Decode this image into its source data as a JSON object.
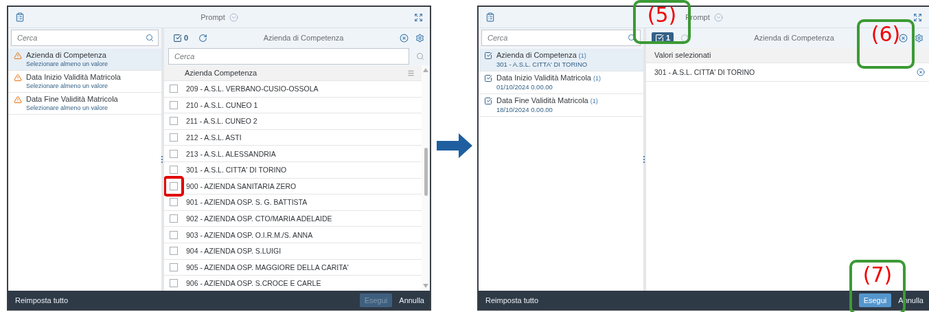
{
  "screens": [
    {
      "title": "Prompt",
      "search": {
        "placeholder": "Cerca"
      },
      "prompts": [
        {
          "label": "Azienda di Competenza",
          "kind": "missing",
          "note": "Selezionare almeno un valore",
          "selected": true
        },
        {
          "label": "Data Inizio Validità Matricola",
          "kind": "missing",
          "note": "Selezionare almeno un valore",
          "selected": false
        },
        {
          "label": "Data Fine Validità Matricola",
          "kind": "missing",
          "note": "Selezionare almeno un valore",
          "selected": false
        }
      ],
      "panel": {
        "kind": "list",
        "selection_count": {
          "label": "0",
          "active": false
        },
        "refresh_disabled": false,
        "title": "Azienda di Competenza",
        "search": {
          "placeholder": "Cerca"
        },
        "column": "Azienda Competenza",
        "rows": [
          {
            "label": "209 - A.S.L. VERBANO-CUSIO-OSSOLA",
            "checked": false,
            "marked": false
          },
          {
            "label": "210 - A.S.L. CUNEO 1",
            "checked": false,
            "marked": false
          },
          {
            "label": "211 - A.S.L. CUNEO 2",
            "checked": false,
            "marked": false
          },
          {
            "label": "212 - A.S.L. ASTI",
            "checked": false,
            "marked": false
          },
          {
            "label": "213 - A.S.L. ALESSANDRIA",
            "checked": false,
            "marked": false
          },
          {
            "label": "301 - A.S.L. CITTA' DI TORINO",
            "checked": false,
            "marked": false
          },
          {
            "label": "900 - AZIENDA SANITARIA ZERO",
            "checked": false,
            "marked": true
          },
          {
            "label": "901 - AZIENDA OSP. S. G. BATTISTA",
            "checked": false,
            "marked": false
          },
          {
            "label": "902 - AZIENDA OSP. CTO/MARIA ADELAIDE",
            "checked": false,
            "marked": false
          },
          {
            "label": "903 - AZIENDA OSP. O.I.R.M./S. ANNA",
            "checked": false,
            "marked": false
          },
          {
            "label": "904 - AZIENDA OSP. S.LUIGI",
            "checked": false,
            "marked": false
          },
          {
            "label": "905 - AZIENDA OSP. MAGGIORE DELLA CARITA'",
            "checked": false,
            "marked": false
          },
          {
            "label": "906 - AZIENDA OSP. S.CROCE E CARLE",
            "checked": false,
            "marked": false
          }
        ]
      },
      "footer": {
        "reset": "Reimposta tutto",
        "run": {
          "label": "Esegui",
          "disabled": true
        },
        "cancel": "Annulla"
      }
    },
    {
      "title": "Prompt",
      "search": {
        "placeholder": "Cerca"
      },
      "prompts": [
        {
          "label": "Azienda di Competenza",
          "kind": "filled",
          "count": "(1)",
          "note": "301 - A.S.L. CITTA' DI TORINO",
          "selected": true
        },
        {
          "label": "Data Inizio Validità Matricola",
          "kind": "filled",
          "count": "(1)",
          "note": "01/10/2024 0.00.00",
          "selected": false
        },
        {
          "label": "Data Fine Validità Matricola",
          "kind": "filled",
          "count": "(1)",
          "note": "18/10/2024 0.00.00",
          "selected": false
        }
      ],
      "panel": {
        "kind": "selected",
        "selection_count": {
          "label": "1",
          "active": true
        },
        "refresh_disabled": true,
        "title": "Azienda di Competenza",
        "header": "Valori selezionati",
        "values": [
          "301 - A.S.L. CITTA' DI TORINO"
        ]
      },
      "footer": {
        "reset": "Reimposta tutto",
        "run": {
          "label": "Esegui",
          "disabled": false
        },
        "cancel": "Annulla"
      },
      "callouts": [
        {
          "label": "(5)"
        },
        {
          "label": "(6)"
        },
        {
          "label": "(7)"
        }
      ]
    }
  ]
}
